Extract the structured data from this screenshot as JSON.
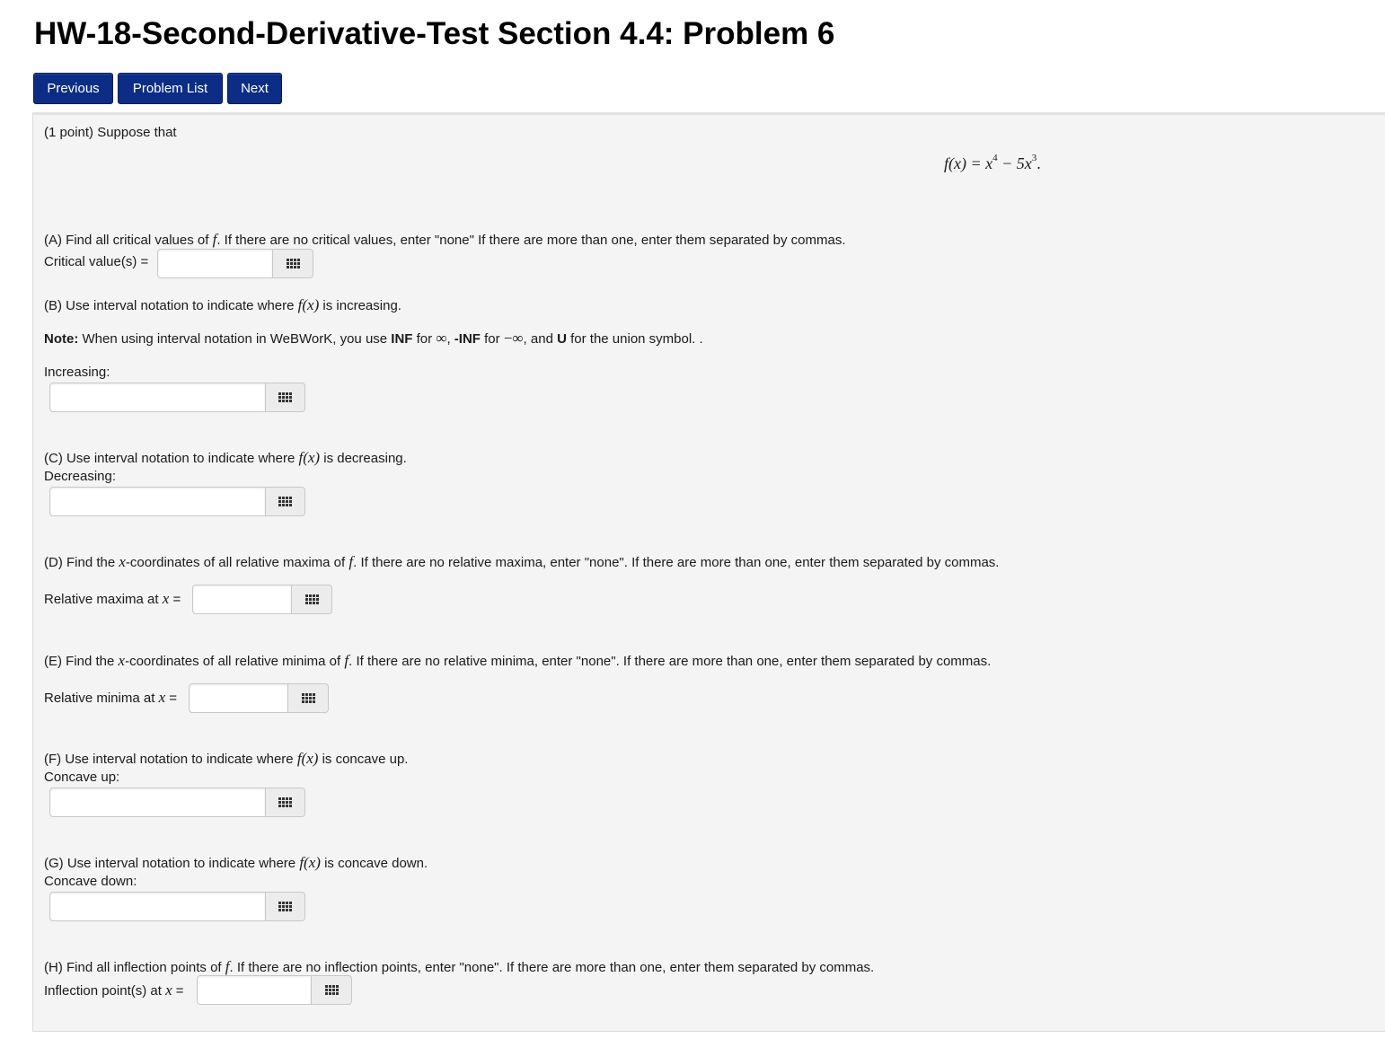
{
  "page": {
    "title": "HW-18-Second-Derivative-Test Section 4.4: Problem 6"
  },
  "nav": {
    "previous": "Previous",
    "problem_list": "Problem List",
    "next": "Next"
  },
  "problem": {
    "intro": "(1 point) Suppose that",
    "equation": {
      "lhs": "f(x) = x",
      "exp1": "4",
      "mid": " − 5x",
      "exp2": "3",
      "end": "."
    },
    "A": {
      "q_pre": "(A) Find all critical values of",
      "var": "f",
      "q_post": ". If there are no critical values, enter \"none\" If there are more than one, enter them separated by commas.",
      "label": "Critical value(s) =",
      "value": ""
    },
    "B": {
      "q_pre": "(B) Use interval notation to indicate where",
      "fx": "f(x)",
      "q_post": "is increasing.",
      "note_label": "Note:",
      "note_1": "When using interval notation in WeBWorK, you use",
      "note_inf": "INF",
      "note_2": "for",
      "note_sym_inf": "∞",
      "note_3": ",",
      "note_neginf": "-INF",
      "note_4": "for",
      "note_sym_neginf": "−∞",
      "note_5": ", and",
      "note_u": "U",
      "note_6": "for the union symbol. .",
      "label": "Increasing:",
      "value": ""
    },
    "C": {
      "q_pre": "(C) Use interval notation to indicate where",
      "fx": "f(x)",
      "q_post": "is decreasing.",
      "label": "Decreasing:",
      "value": ""
    },
    "D": {
      "q_pre": "(D) Find the",
      "var": "x",
      "q_mid": "-coordinates of all relative maxima of",
      "var2": "f",
      "q_post": ". If there are no relative maxima, enter \"none\". If there are more than one, enter them separated by commas.",
      "label": "Relative maxima at",
      "label_var": "x",
      "label_eq": "=",
      "value": ""
    },
    "E": {
      "q_pre": "(E) Find the",
      "var": "x",
      "q_mid": "-coordinates of all relative minima of",
      "var2": "f",
      "q_post": ". If there are no relative minima, enter \"none\". If there are more than one, enter them separated by commas.",
      "label": "Relative minima at",
      "label_var": "x",
      "label_eq": "=",
      "value": ""
    },
    "F": {
      "q_pre": "(F) Use interval notation to indicate where",
      "fx": "f(x)",
      "q_post": "is concave up.",
      "label": "Concave up:",
      "value": ""
    },
    "G": {
      "q_pre": "(G) Use interval notation to indicate where",
      "fx": "f(x)",
      "q_post": "is concave down.",
      "label": "Concave down:",
      "value": ""
    },
    "H": {
      "q_pre": "(H) Find all inflection points of",
      "var": "f",
      "q_post": ". If there are no inflection points, enter \"none\". If there are more than one, enter them separated by commas.",
      "label": "Inflection point(s) at",
      "label_var": "x",
      "label_eq": "=",
      "value": ""
    }
  },
  "icons": {
    "palette": "equation-palette-icon"
  },
  "colors": {
    "nav_button": "#0b2d86",
    "panel_bg": "#f4f4f4"
  }
}
